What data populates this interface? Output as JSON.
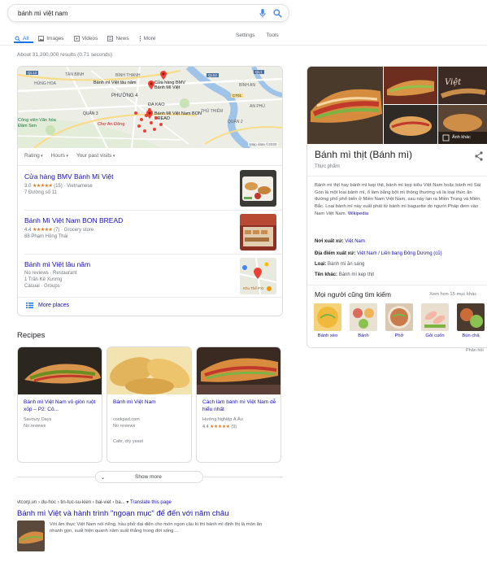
{
  "search": {
    "query": "bánh mì việt nam"
  },
  "tabs": [
    {
      "label": "All",
      "icon": "search-icon",
      "active": true
    },
    {
      "label": "Images",
      "icon": "image-icon"
    },
    {
      "label": "Videos",
      "icon": "video-icon"
    },
    {
      "label": "News",
      "icon": "news-icon"
    },
    {
      "label": "More",
      "icon": "more-dots-icon"
    }
  ],
  "tools": {
    "settings": "Settings",
    "tools": "Tools"
  },
  "stats": "About 31,200,000 results (0.71 seconds)",
  "map": {
    "labels": [
      "BÌNH THẠNH",
      "QUẬN 3",
      "PHƯỜNG 4",
      "ĐA KAO",
      "Công viên Văn hóa Đầm Sen",
      "Chợ An Đông",
      "TÂN BÌNH",
      "THỦ THIÊM",
      "AN PHÚ",
      "BÌNH AN",
      "QUẬN 2",
      "HÙNG HOA"
    ],
    "pins": [
      "Bánh mì Việt lâu năm",
      "Cửa hàng BMV Bánh Mì Việt",
      "Bánh Mì Việt Nam BON BREAD"
    ],
    "data_credit": "Map data ©2020",
    "road_codes": [
      "QL13",
      "QL1",
      "QL52",
      "CT01"
    ]
  },
  "filters": [
    "Rating",
    "Hours",
    "Your past visits"
  ],
  "places": [
    {
      "name": "Cửa hàng BMV Bánh Mì Việt",
      "rating": "3.0",
      "stars": "★★★★★",
      "reviews": "(15)",
      "category": "Vietnamese",
      "address": "7 Đường số 11"
    },
    {
      "name": "Bánh Mì Việt Nam BON BREAD",
      "rating": "4.4",
      "stars": "★★★★★",
      "reviews": "(7)",
      "category": "Grocery store",
      "address": "88 Phạm Hồng Thái"
    },
    {
      "name": "Bánh mì Việt lâu năm",
      "rating": "No reviews",
      "category": "Restaurant",
      "address": "1 Trần Kế Xương",
      "extra": "Casual · Groups",
      "thumb_label": "Khu Thể PXI"
    }
  ],
  "more_places": "More places",
  "recipes_title": "Recipes",
  "recipes": [
    {
      "title": "Bánh mì Việt Nam vỏ giòn ruột xốp – P2: Cô...",
      "source": "Savoury Days",
      "reviews": "No reviews"
    },
    {
      "title": "Bánh mì Việt Nam",
      "source": "cookpad.com",
      "reviews": "No reviews",
      "extra": "Cafe, dry yeast"
    },
    {
      "title": "Cách làm bánh mì Việt Nam dễ hiểu nhất",
      "source": "Hướng Nghiệp Á Âu",
      "rating": "4.4",
      "stars": "★★★★★",
      "reviews": "(9)"
    }
  ],
  "show_more": "Show more",
  "organic": {
    "cite": "vtcorp.vn › du-hoc › tin-tuc-su-kien › bai-viet › ba...",
    "translate": "Translate this page",
    "title": "Bánh mì Việt và hành trình \"ngoạn mục\" để đến với năm châu",
    "snippet": "Với ẩm thực Việt Nam nói riêng, hầu phở đại diện cho món ngon câu kì thì bánh mì định thị là món ăn nhanh gọn, xuất hiện quanh năm suất thắng trong đời sống ..."
  },
  "knowledge_panel": {
    "title": "Bánh mì thịt (Bánh mì)",
    "subtitle": "Thực phẩm",
    "image_more": "Ảnh khác",
    "description": "Bánh mì thịt hay bánh mì kẹp thịt, bánh mì kẹp kiểu Việt Nam hoặc bánh mì Sài Gòn là một loại bánh mì, ổ làm bằng bột mì thông thường và là loại thức ăn đường phố phổ biến ở Miền Nam Việt Nam, sau này lan ra Miền Trung và Miền Bắc. Loại bánh mì này xuất phát từ bánh mì baguette do người Pháp đem vào Nam Việt Nam.",
    "desc_link": "Wikipedia",
    "facts": [
      {
        "key": "Nơi xuất xứ:",
        "value": "Việt Nam",
        "link": true
      },
      {
        "key": "Địa điểm xuất xứ:",
        "value": "Việt Nam / Liên bang Đông Dương (cũ)",
        "link": true
      },
      {
        "key": "Loại:",
        "value": "Bánh mì ăn sáng",
        "link": false
      },
      {
        "key": "Tên khác:",
        "value": "Bánh mì kẹp thịt",
        "link": false
      }
    ],
    "people_also_search": "Mọi người cũng tìm kiếm",
    "view_more": "Xem hơn 15 mục khác",
    "pas_items": [
      "Bánh xèo",
      "Bánh",
      "Phở",
      "Gỏi cuốn",
      "Bún chả"
    ],
    "feedback": "Phản hồi"
  },
  "colors": {
    "link": "#1a0dab",
    "accent": "#1a73e8",
    "star": "#e7711b",
    "pin": "#ea4335"
  }
}
